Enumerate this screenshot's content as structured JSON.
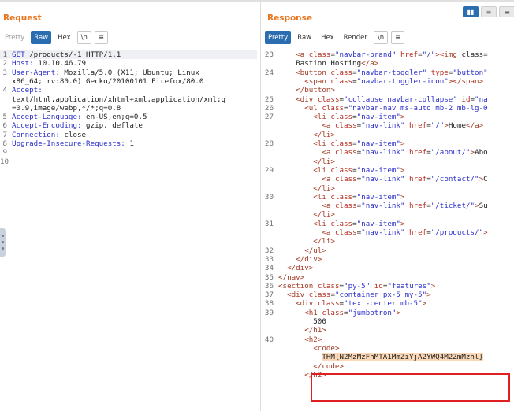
{
  "request": {
    "title": "Request",
    "toolbar": {
      "pretty": "Pretty",
      "raw": "Raw",
      "hex": "Hex",
      "newline": "\\n",
      "menu": "≡"
    },
    "lines": [
      {
        "n": "1",
        "key": "GET",
        "text": " /products/-1 HTTP/1.1"
      },
      {
        "n": "2",
        "key": "Host:",
        "text": " 10.10.46.79"
      },
      {
        "n": "3",
        "key": "User-Agent:",
        "text": " Mozilla/5.0 (X11; Ubuntu; Linux"
      },
      {
        "n": "",
        "key": "",
        "text": "x86_64; rv:80.0) Gecko/20100101 Firefox/80.0"
      },
      {
        "n": "4",
        "key": "Accept:",
        "text": ""
      },
      {
        "n": "",
        "key": "",
        "text": "text/html,application/xhtml+xml,application/xml;q"
      },
      {
        "n": "",
        "key": "",
        "text": "=0.9,image/webp,*/*;q=0.8"
      },
      {
        "n": "5",
        "key": "Accept-Language:",
        "text": " en-US,en;q=0.5"
      },
      {
        "n": "6",
        "key": "Accept-Encoding:",
        "text": " gzip, deflate"
      },
      {
        "n": "7",
        "key": "Connection:",
        "text": " close"
      },
      {
        "n": "8",
        "key": "Upgrade-Insecure-Requests:",
        "text": " 1"
      },
      {
        "n": "9",
        "key": "",
        "text": ""
      },
      {
        "n": "10",
        "key": "",
        "text": ""
      }
    ]
  },
  "response": {
    "title": "Response",
    "toolbar": {
      "pretty": "Pretty",
      "raw": "Raw",
      "hex": "Hex",
      "render": "Render",
      "newline": "\\n",
      "menu": "≡"
    },
    "lines": [
      {
        "n": "23",
        "code": "    <a class=\"navbar-brand\" href=\"/\"><img class="
      },
      {
        "n": "",
        "code": "    Bastion Hosting</a>"
      },
      {
        "n": "24",
        "code": "    <button class=\"navbar-toggler\" type=\"button\""
      },
      {
        "n": "",
        "code": "      <span class=\"navbar-toggler-icon\"></span>"
      },
      {
        "n": "",
        "code": "    </button>"
      },
      {
        "n": "25",
        "code": "    <div class=\"collapse navbar-collapse\" id=\"na"
      },
      {
        "n": "26",
        "code": "      <ul class=\"navbar-nav ms-auto mb-2 mb-lg-0"
      },
      {
        "n": "27",
        "code": "        <li class=\"nav-item\">"
      },
      {
        "n": "",
        "code": "          <a class=\"nav-link\" href=\"/\">Home</a>"
      },
      {
        "n": "",
        "code": "        </li>"
      },
      {
        "n": "28",
        "code": "        <li class=\"nav-item\">"
      },
      {
        "n": "",
        "code": "          <a class=\"nav-link\" href=\"/about/\">Abo"
      },
      {
        "n": "",
        "code": "        </li>"
      },
      {
        "n": "29",
        "code": "        <li class=\"nav-item\">"
      },
      {
        "n": "",
        "code": "          <a class=\"nav-link\" href=\"/contact/\">C"
      },
      {
        "n": "",
        "code": "        </li>"
      },
      {
        "n": "30",
        "code": "        <li class=\"nav-item\">"
      },
      {
        "n": "",
        "code": "          <a class=\"nav-link\" href=\"/ticket/\">Su"
      },
      {
        "n": "",
        "code": "        </li>"
      },
      {
        "n": "31",
        "code": "        <li class=\"nav-item\">"
      },
      {
        "n": "",
        "code": "          <a class=\"nav-link\" href=\"/products/\">"
      },
      {
        "n": "",
        "code": "        </li>"
      },
      {
        "n": "32",
        "code": "      </ul>"
      },
      {
        "n": "33",
        "code": "    </div>"
      },
      {
        "n": "34",
        "code": "  </div>"
      },
      {
        "n": "35",
        "code": "</nav>"
      },
      {
        "n": "36",
        "code": "<section class=\"py-5\" id=\"features\">"
      },
      {
        "n": "37",
        "code": "  <div class=\"container px-5 my-5\">"
      },
      {
        "n": "38",
        "code": "    <div class=\"text-center mb-5\">"
      },
      {
        "n": "39",
        "code": "      <h1 class=\"jumbotron\">"
      },
      {
        "n": "",
        "code": "        500"
      },
      {
        "n": "",
        "code": "      </h1>"
      },
      {
        "n": "40",
        "code": "      <h2>"
      },
      {
        "n": "",
        "code": "        <code>"
      },
      {
        "n": "",
        "code": "          THM{N2MzMzFhMTA1MmZiYjA2YWQ4M2ZmMzhl}"
      },
      {
        "n": "",
        "code": "        </code>"
      },
      {
        "n": "",
        "code": "      </h2>"
      }
    ],
    "flag": "THM{N2MzMzFhMTA1MmZiYjA2YWQ4M2ZmMzhl}"
  },
  "layout_icons": [
    "split-columns-icon",
    "split-rows-icon",
    "single-pane-icon"
  ],
  "colors": {
    "accent": "#e8741c",
    "active_button": "#2a6db0",
    "highlight_box": "#e02020",
    "flag_bg": "#fbd9b8"
  }
}
